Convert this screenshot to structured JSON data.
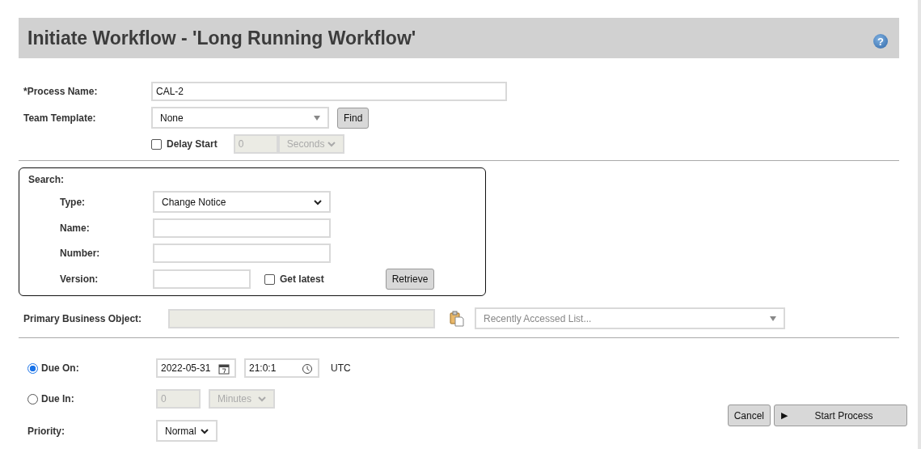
{
  "header": {
    "title": "Initiate Workflow - 'Long Running Workflow'",
    "help_icon": "?"
  },
  "process_name": {
    "label": "*Process Name:",
    "value": "CAL-2"
  },
  "team_template": {
    "label": "Team Template:",
    "value": "None",
    "button": "Find"
  },
  "delay_start": {
    "label": "Delay Start",
    "checked": false,
    "amount": "0",
    "unit": "Seconds"
  },
  "search": {
    "title": "Search:",
    "type": {
      "label": "Type:",
      "value": "Change Notice"
    },
    "name": {
      "label": "Name:"
    },
    "number": {
      "label": "Number:"
    },
    "version": {
      "label": "Version:"
    },
    "get_latest": {
      "label": "Get latest",
      "checked": false
    },
    "button": "Retrieve"
  },
  "primary_business_object": {
    "label": "Primary Business Object:",
    "recent_placeholder": "Recently Accessed List..."
  },
  "due": [
    {
      "kind": "date",
      "label": "Due On:",
      "selected": true,
      "date": "2022-05-31",
      "time": "21:0:1",
      "zone": "UTC"
    },
    {
      "kind": "duration",
      "label": "Due In:",
      "selected": false,
      "amount": "0",
      "unit": "Minutes"
    }
  ],
  "priority": {
    "label": "Priority:",
    "value": "Normal"
  },
  "buttons": [
    {
      "kind": "plain",
      "label": "Cancel"
    },
    {
      "kind": "start",
      "label": "Start Process",
      "icon": "▶"
    }
  ]
}
